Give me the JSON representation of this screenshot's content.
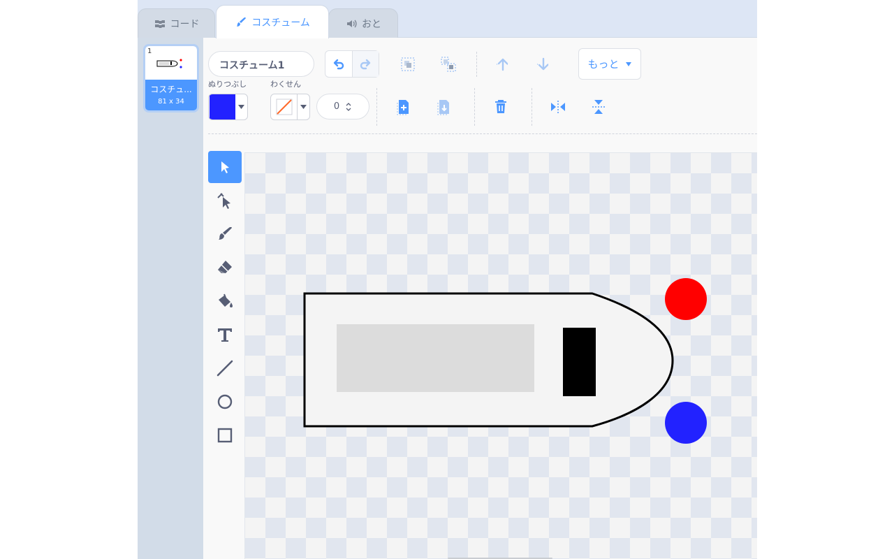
{
  "tabs": [
    {
      "label": "コード",
      "icon": "code-blocks-icon"
    },
    {
      "label": "コスチューム",
      "icon": "brush-icon"
    },
    {
      "label": "おと",
      "icon": "speaker-icon"
    }
  ],
  "costumes": [
    {
      "number": "1",
      "name": "コスチュ...",
      "size": "81 x 34"
    }
  ],
  "toolbar": {
    "costume_name": "コスチューム1",
    "more_label": "もっと",
    "fill_label": "ぬりつぶし",
    "outline_label": "わくせん",
    "outline_width": "0"
  },
  "colors": {
    "accent": "#4c97ff",
    "fill_color": "#2222ff",
    "outline_color": "none",
    "shape_body": "#f4f4f4",
    "window_rect": "#dcdcdc",
    "dot_red": "#ff0000",
    "dot_blue": "#2222ff"
  },
  "tools": [
    "select-tool",
    "reshape-tool",
    "brush-tool",
    "eraser-tool",
    "fill-tool",
    "text-tool",
    "line-tool",
    "circle-tool",
    "rectangle-tool"
  ]
}
